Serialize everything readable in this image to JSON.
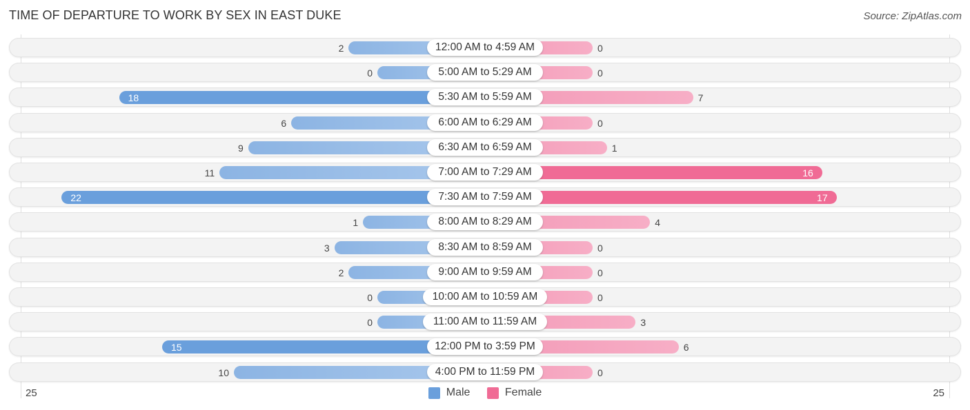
{
  "chart_data": {
    "type": "bar",
    "orientation": "horizontal-diverging",
    "title": "TIME OF DEPARTURE TO WORK BY SEX IN EAST DUKE",
    "source": "Source: ZipAtlas.com",
    "categories": [
      "12:00 AM to 4:59 AM",
      "5:00 AM to 5:29 AM",
      "5:30 AM to 5:59 AM",
      "6:00 AM to 6:29 AM",
      "6:30 AM to 6:59 AM",
      "7:00 AM to 7:29 AM",
      "7:30 AM to 7:59 AM",
      "8:00 AM to 8:29 AM",
      "8:30 AM to 8:59 AM",
      "9:00 AM to 9:59 AM",
      "10:00 AM to 10:59 AM",
      "11:00 AM to 11:59 AM",
      "12:00 PM to 3:59 PM",
      "4:00 PM to 11:59 PM"
    ],
    "series": [
      {
        "name": "Male",
        "color": "#6a9fdc",
        "values": [
          2,
          0,
          18,
          6,
          9,
          11,
          22,
          1,
          3,
          2,
          0,
          0,
          15,
          10
        ]
      },
      {
        "name": "Female",
        "color": "#f06b95",
        "values": [
          0,
          0,
          7,
          0,
          1,
          16,
          17,
          4,
          0,
          0,
          0,
          3,
          6,
          0
        ]
      }
    ],
    "axis": {
      "left_label": "25",
      "right_label": "25",
      "max": 25
    },
    "legend": {
      "position": "bottom-center",
      "entries": [
        "Male",
        "Female"
      ]
    }
  }
}
